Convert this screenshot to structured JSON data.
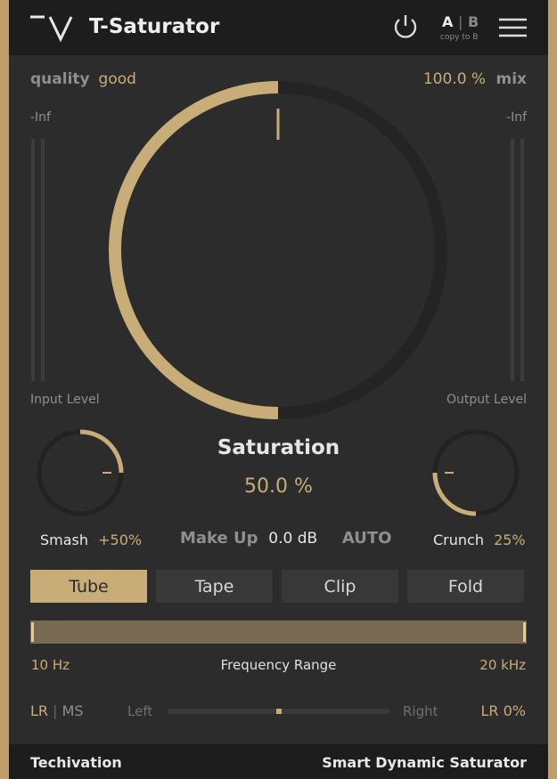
{
  "header": {
    "brand_logo": "tv-logo",
    "title": "T-Saturator",
    "power_icon": "power-icon",
    "ab": {
      "a": "A",
      "sep": "|",
      "b": "B",
      "copy": "copy to B"
    },
    "menu_icon": "hamburger-menu-icon"
  },
  "top": {
    "quality_label": "quality",
    "quality_value": "good",
    "mix_value": "100.0 %",
    "mix_label": "mix"
  },
  "meters": {
    "input_peak": "-Inf",
    "output_peak": "-Inf",
    "input_label": "Input Level",
    "output_label": "Output Level"
  },
  "saturation": {
    "label": "Saturation",
    "value": "50.0 %",
    "amount_fraction": 0.5
  },
  "makeup": {
    "label": "Make Up",
    "value": "0.0 dB",
    "auto": "AUTO"
  },
  "smash": {
    "label": "Smash",
    "value": "+50%",
    "amount_fraction": 0.25
  },
  "crunch": {
    "label": "Crunch",
    "value": "25%",
    "amount_fraction": 0.25
  },
  "modes": {
    "items": [
      "Tube",
      "Tape",
      "Clip",
      "Fold"
    ],
    "active": "Tube"
  },
  "frequency": {
    "low": "10 Hz",
    "label": "Frequency Range",
    "high": "20 kHz"
  },
  "stereo": {
    "lr": "LR",
    "sep": "|",
    "ms": "MS",
    "left": "Left",
    "right": "Right",
    "value": "LR 0%",
    "balance_fraction": 0.5
  },
  "footer": {
    "company": "Techivation",
    "tagline": "Smart Dynamic Saturator"
  },
  "colors": {
    "accent": "#c9ad79",
    "panel": "#2c2c2c",
    "header": "#1d1d1d"
  }
}
